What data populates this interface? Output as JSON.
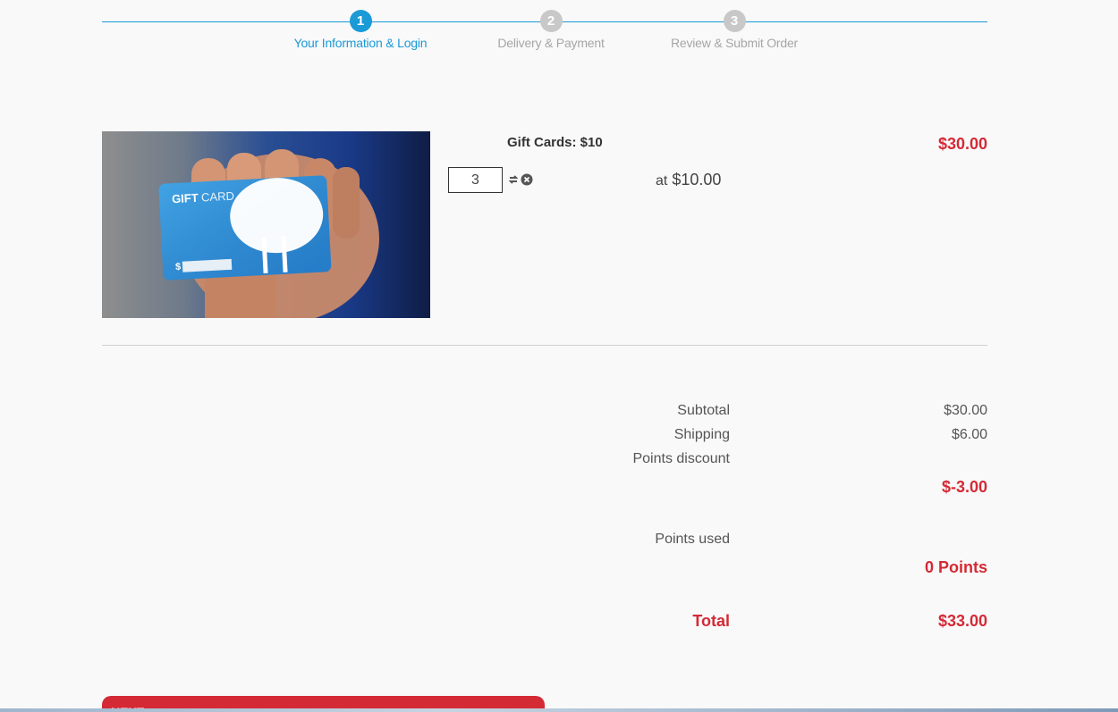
{
  "steps": [
    {
      "number": "1",
      "label": "Your Information & Login",
      "active": true
    },
    {
      "number": "2",
      "label": "Delivery & Payment",
      "active": false
    },
    {
      "number": "3",
      "label": "Review & Submit Order",
      "active": false
    }
  ],
  "cart": {
    "item_name": "Gift Cards: $10",
    "item_total": "$30.00",
    "quantity": "3",
    "unit_price_prefix": "at",
    "unit_price": "$10.00",
    "image": {
      "card_brand_word1": "GIFT",
      "card_brand_word2": "CARD",
      "card_dollar": "$"
    }
  },
  "totals": {
    "subtotal_label": "Subtotal",
    "subtotal_value": "$30.00",
    "shipping_label": "Shipping",
    "shipping_value": "$6.00",
    "points_discount_label": "Points discount",
    "points_discount_value": "$-3.00",
    "points_used_label": "Points used",
    "points_used_value": "0 Points",
    "total_label": "Total",
    "total_value": "$33.00"
  },
  "actions": {
    "next_label": "NEXT"
  },
  "colors": {
    "accent_blue": "#1a9ad6",
    "inactive_gray": "#c8c8c8",
    "price_red": "#d42a35"
  },
  "icons": {
    "update": "refresh-icon",
    "remove": "remove-circle-icon",
    "next": "arrow-right-icon"
  }
}
